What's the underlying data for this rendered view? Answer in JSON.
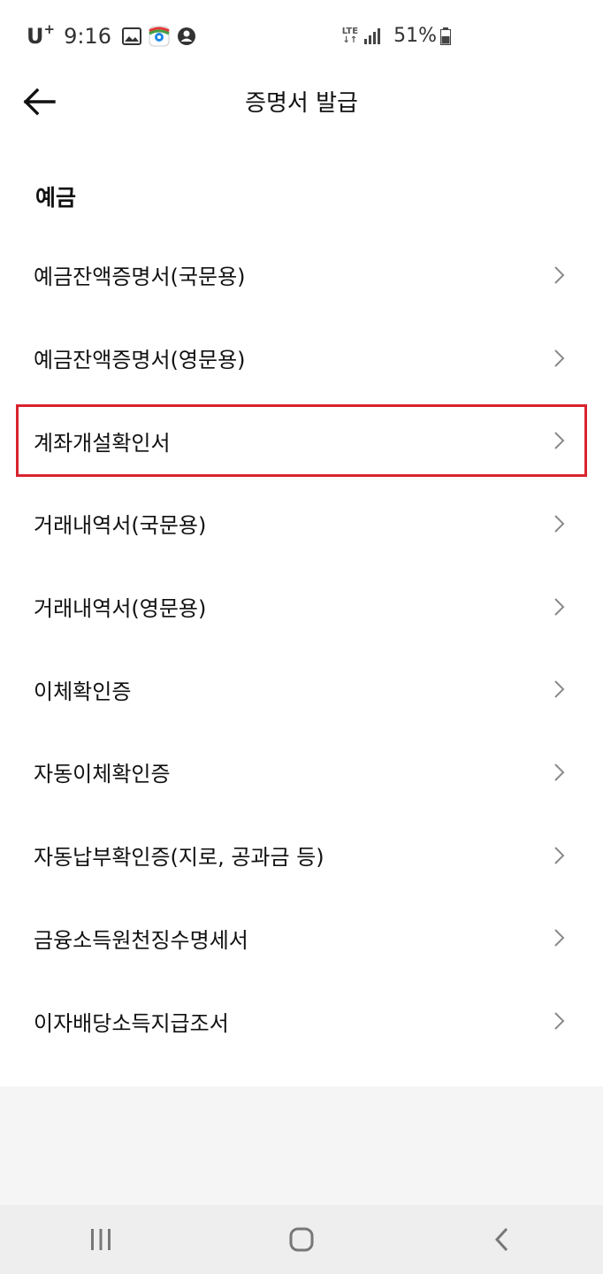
{
  "status_bar": {
    "carrier": "U",
    "carrier_sup": "+",
    "time": "9:16",
    "network": "LTE",
    "battery": "51%",
    "icons": [
      "image-icon",
      "maps-icon",
      "account-icon",
      "signal-icon",
      "battery-icon"
    ]
  },
  "header": {
    "title": "증명서 발급",
    "back_icon": "arrow-left-icon"
  },
  "section": {
    "title": "예금"
  },
  "items": [
    {
      "label": "예금잔액증명서(국문용)"
    },
    {
      "label": "예금잔액증명서(영문용)"
    },
    {
      "label": "계좌개설확인서"
    },
    {
      "label": "거래내역서(국문용)"
    },
    {
      "label": "거래내역서(영문용)"
    },
    {
      "label": "이체확인증"
    },
    {
      "label": "자동이체확인증"
    },
    {
      "label": "자동납부확인증(지로, 공과금 등)"
    },
    {
      "label": "금융소득원천징수명세서"
    },
    {
      "label": "이자배당소득지급조서"
    }
  ],
  "highlight_color": "#d9232e",
  "nav": {
    "icons": [
      "recent-apps-icon",
      "home-icon",
      "back-icon"
    ]
  }
}
